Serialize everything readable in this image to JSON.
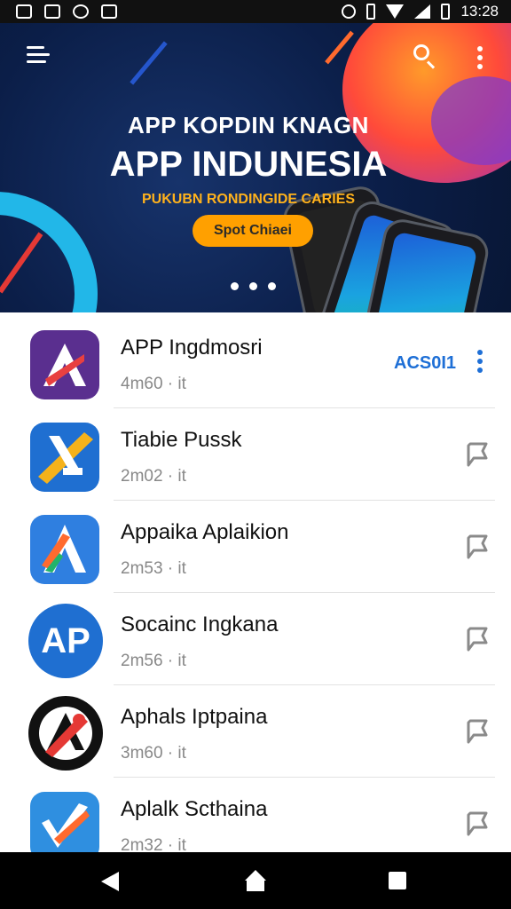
{
  "status_bar": {
    "time": "13:28"
  },
  "banner": {
    "subtitle": "APP KOPDIN KNAGN",
    "title": "APP INDUNESIA",
    "tagline": "PUKUBN RONDINGIDE CARIES",
    "button_label": "Spot Chiaei"
  },
  "apps": [
    {
      "title": "APP Ingdmosri",
      "meta": "4m60 · it",
      "action": "ACS0I1",
      "icon_text": "",
      "icon_colors": [
        "#5a2f8f",
        "#e84040"
      ]
    },
    {
      "title": "Tiabie Pussk",
      "meta": "2m02 · it",
      "icon_text": "",
      "icon_colors": [
        "#1f6fd1",
        "#f5b21b"
      ]
    },
    {
      "title": "Appaika Aplaikion",
      "meta": "2m53 · it",
      "icon_text": "",
      "icon_colors": [
        "#2f7fe0",
        "#ff6a2e"
      ]
    },
    {
      "title": "Socainc Ingkana",
      "meta": "2m56 · it",
      "icon_text": "AP",
      "icon_colors": [
        "#1f6fd1",
        "#ffffff"
      ]
    },
    {
      "title": "Aphals Iptpaina",
      "meta": "3m60 · it",
      "icon_text": "",
      "icon_colors": [
        "#111111",
        "#e53935"
      ]
    },
    {
      "title": "Aplalk Scthaina",
      "meta": "2m32 · it",
      "icon_text": "",
      "icon_colors": [
        "#2f8fe0",
        "#ff6a2e"
      ]
    }
  ],
  "icons": {
    "menu": "menu-icon",
    "search": "search-icon",
    "more": "more-vert-icon",
    "pin": "pin-icon",
    "back": "back-icon",
    "home": "home-icon",
    "recents": "recents-icon"
  }
}
